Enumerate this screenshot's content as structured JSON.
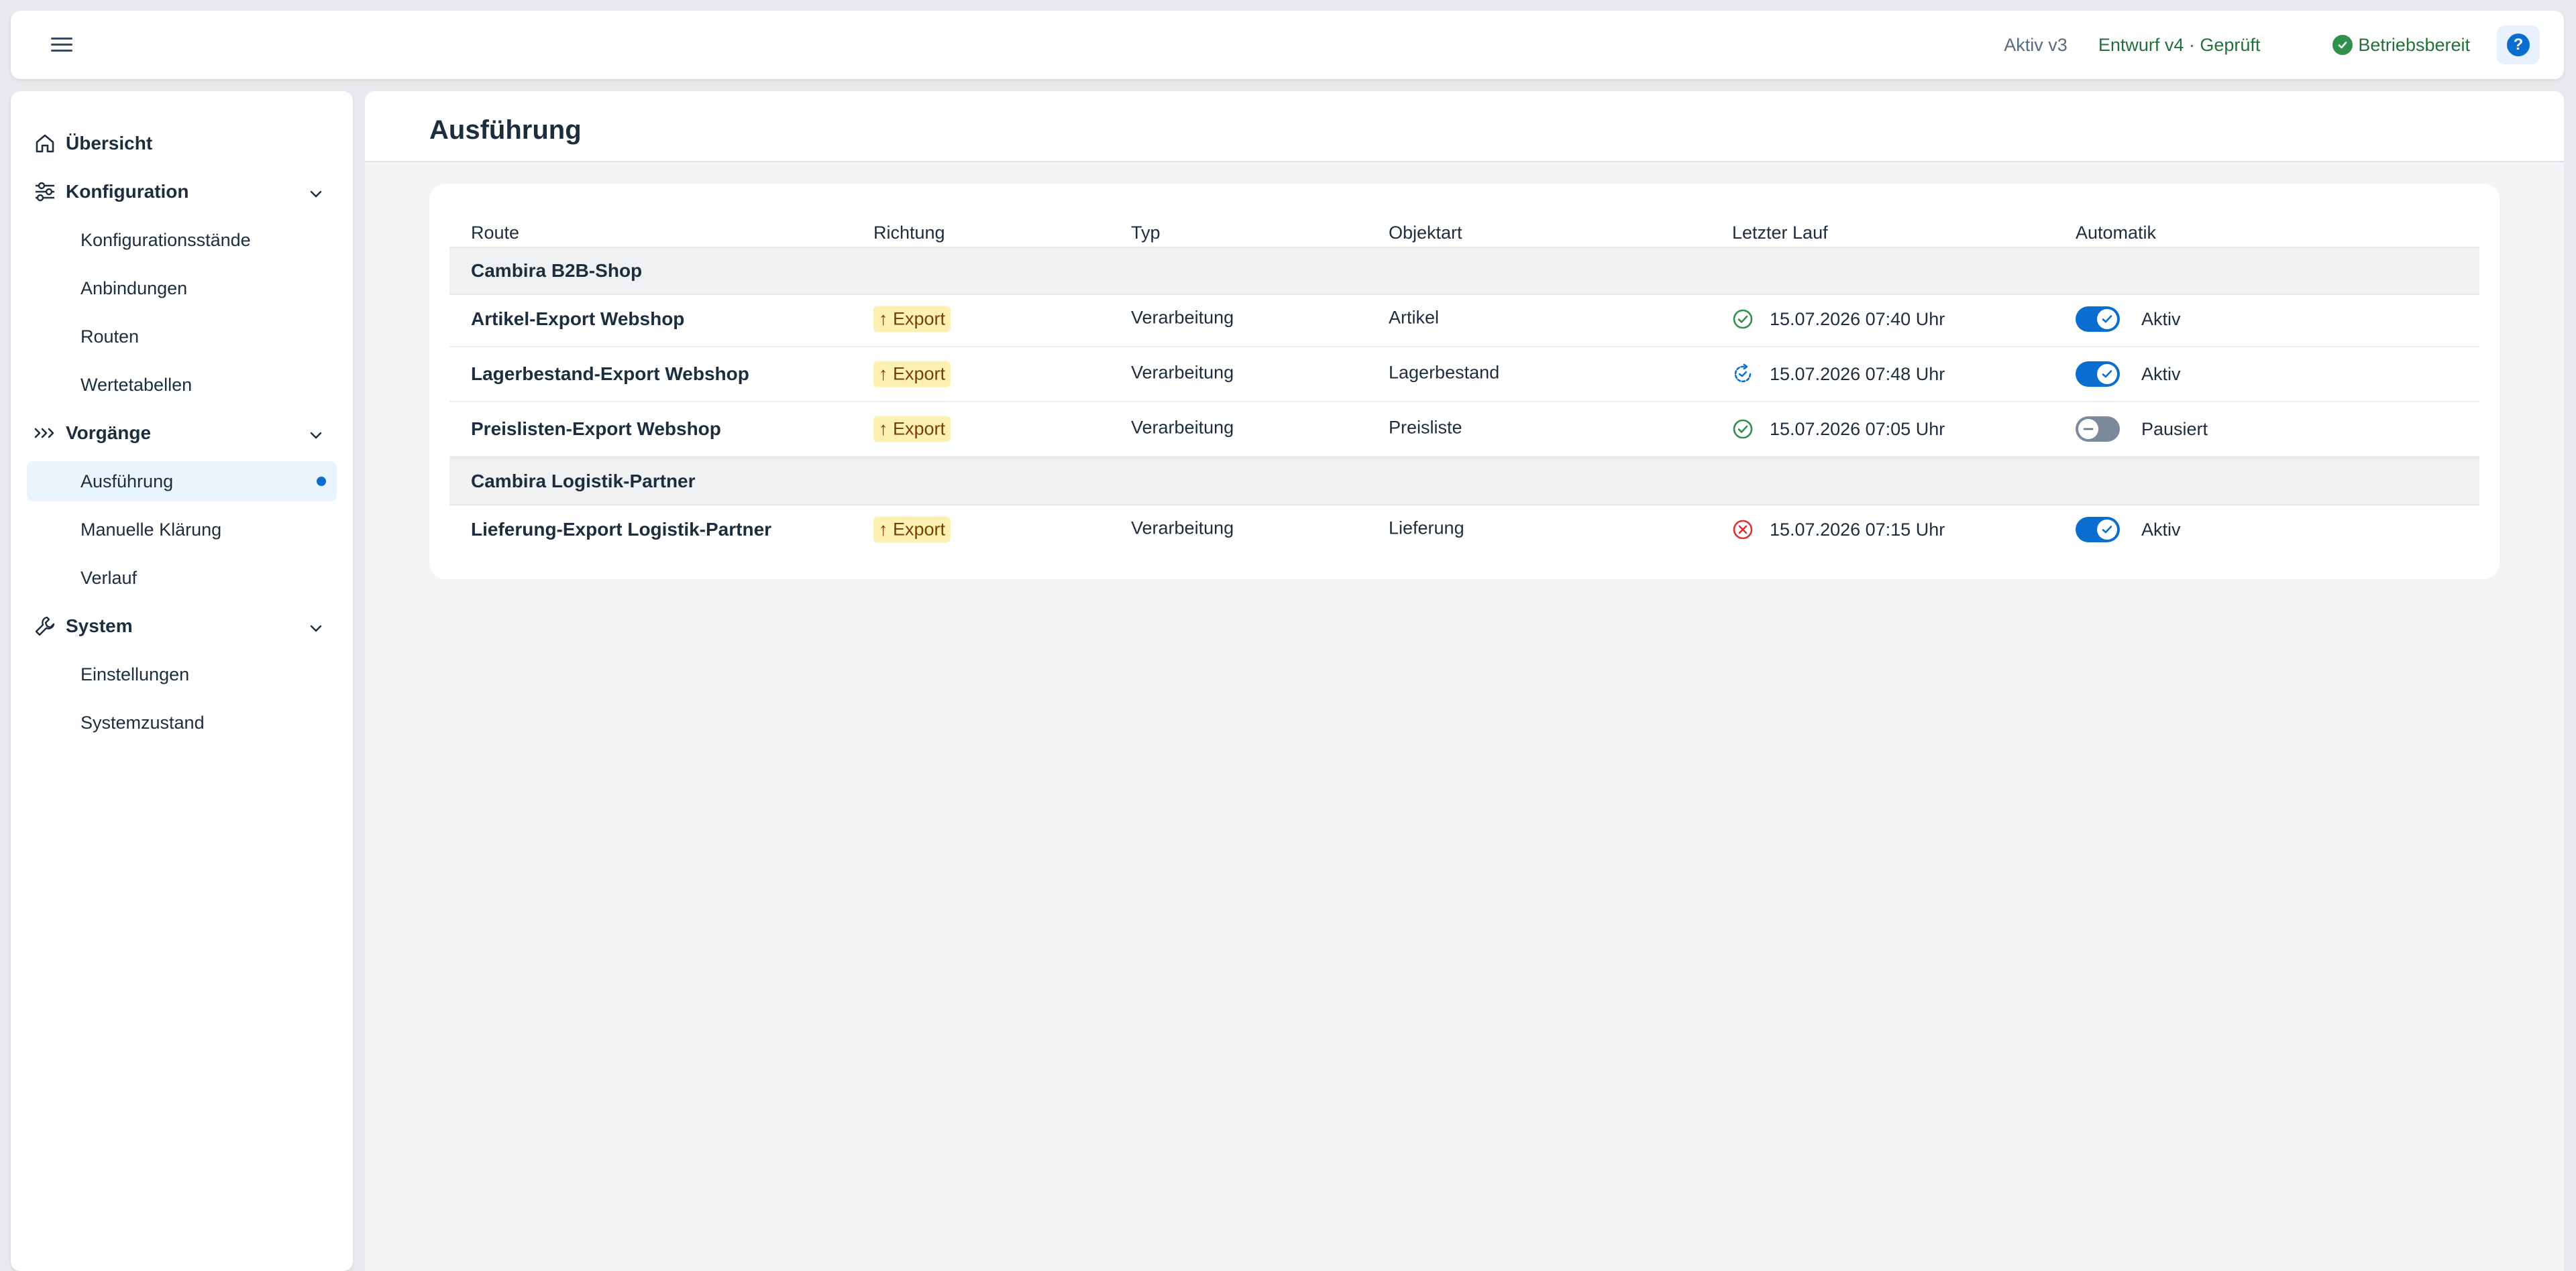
{
  "shell": {
    "version_active": "Aktiv v3",
    "version_draft": "Entwurf v4 · Geprüft",
    "status": "Betriebsbereit",
    "help_label": "?",
    "icons": {
      "menu": "hamburger-menu-icon",
      "status": "check-circle-icon",
      "help": "help-icon"
    }
  },
  "sidebar": {
    "items": [
      {
        "label": "Übersicht",
        "level": "top",
        "icon": "home-icon"
      },
      {
        "label": "Konfiguration",
        "level": "top",
        "icon": "sliders-icon",
        "expanded": true
      },
      {
        "label": "Konfigurationsstände",
        "level": "sub"
      },
      {
        "label": "Anbindungen",
        "level": "sub"
      },
      {
        "label": "Routen",
        "level": "sub"
      },
      {
        "label": "Wertetabellen",
        "level": "sub"
      },
      {
        "label": "Vorgänge",
        "level": "top",
        "icon": "process-icon",
        "expanded": true
      },
      {
        "label": "Ausführung",
        "level": "sub",
        "selected": true
      },
      {
        "label": "Manuelle Klärung",
        "level": "sub"
      },
      {
        "label": "Verlauf",
        "level": "sub"
      },
      {
        "label": "System",
        "level": "top",
        "icon": "wrench-icon",
        "expanded": true
      },
      {
        "label": "Einstellungen",
        "level": "sub"
      },
      {
        "label": "Systemzustand",
        "level": "sub"
      }
    ]
  },
  "page": {
    "title": "Ausführung"
  },
  "table": {
    "columns": [
      "Route",
      "Richtung",
      "Typ",
      "Objektart",
      "Letzter Lauf",
      "Automatik"
    ],
    "groups": [
      {
        "name": "Cambira B2B-Shop",
        "rows": [
          {
            "route": "Artikel-Export Webshop",
            "direction": "↑ Export",
            "type": "Verarbeitung",
            "object": "Artikel",
            "last_run": "15.07.2026 07:40 Uhr",
            "run_status": "success",
            "automatic": "Aktiv",
            "automatic_on": true
          },
          {
            "route": "Lagerbestand-Export Webshop",
            "direction": "↑ Export",
            "type": "Verarbeitung",
            "object": "Lagerbestand",
            "last_run": "15.07.2026 07:48 Uhr",
            "run_status": "running",
            "automatic": "Aktiv",
            "automatic_on": true
          },
          {
            "route": "Preislisten-Export Webshop",
            "direction": "↑ Export",
            "type": "Verarbeitung",
            "object": "Preisliste",
            "last_run": "15.07.2026 07:05 Uhr",
            "run_status": "success",
            "automatic": "Pausiert",
            "automatic_on": false
          }
        ]
      },
      {
        "name": "Cambira Logistik-Partner",
        "rows": [
          {
            "route": "Lieferung-Export Logistik-Partner",
            "direction": "↑ Export",
            "type": "Verarbeitung",
            "object": "Lieferung",
            "last_run": "15.07.2026 07:15 Uhr",
            "run_status": "error",
            "automatic": "Aktiv",
            "automatic_on": true
          }
        ]
      }
    ]
  },
  "colors": {
    "accent": "#0a6ed1",
    "success": "#30914c",
    "error": "#e02f2f",
    "badge_bg": "#fdf0b3",
    "badge_text": "#7a3e00"
  }
}
